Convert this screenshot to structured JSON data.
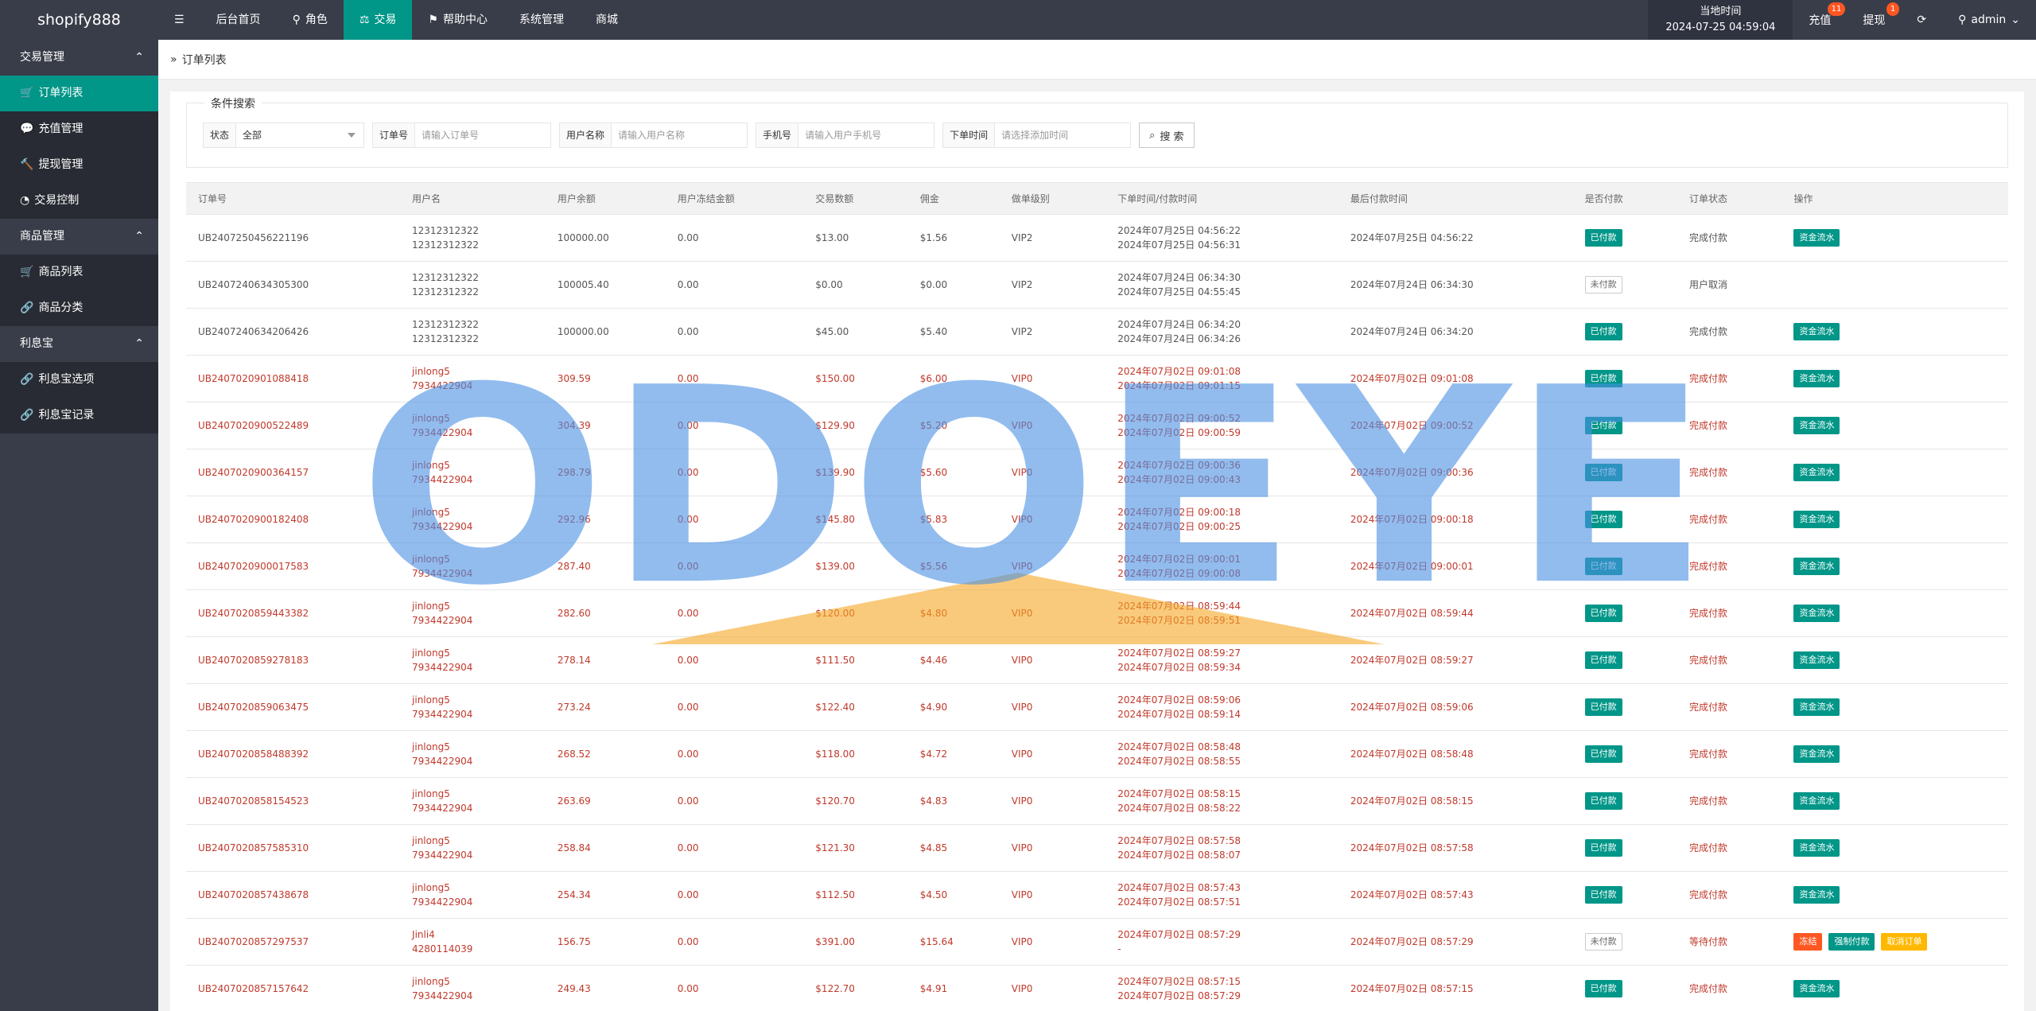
{
  "header": {
    "logo": "shopify888",
    "menu_icon": "menu-icon",
    "nav": [
      {
        "label": "后台首页",
        "icon": ""
      },
      {
        "label": "角色",
        "icon": "user-icon"
      },
      {
        "label": "交易",
        "icon": "scale-icon",
        "active": true
      },
      {
        "label": "帮助中心",
        "icon": "flag-icon"
      },
      {
        "label": "系统管理",
        "icon": ""
      },
      {
        "label": "商城",
        "icon": ""
      }
    ],
    "clock_label": "当地时间",
    "clock_value": "2024-07-25 04:59:04",
    "recharge_label": "充值",
    "recharge_badge": "11",
    "withdraw_label": "提现",
    "withdraw_badge": "1",
    "user": "admin"
  },
  "sidebar": {
    "groups": [
      {
        "label": "交易管理",
        "items": [
          {
            "label": "订单列表",
            "icon": "cart-icon",
            "active": true
          },
          {
            "label": "充值管理",
            "icon": "chat-icon"
          },
          {
            "label": "提现管理",
            "icon": "hammer-icon"
          },
          {
            "label": "交易控制",
            "icon": "dashboard-icon"
          }
        ]
      },
      {
        "label": "商品管理",
        "items": [
          {
            "label": "商品列表",
            "icon": "cart-icon"
          },
          {
            "label": "商品分类",
            "icon": "link-icon"
          }
        ]
      },
      {
        "label": "利息宝",
        "items": [
          {
            "label": "利息宝选项",
            "icon": "link-icon"
          },
          {
            "label": "利息宝记录",
            "icon": "link-icon"
          }
        ]
      }
    ]
  },
  "breadcrumb": {
    "label": "订单列表"
  },
  "filter": {
    "legend": "条件搜索",
    "status_label": "状态",
    "status_value": "全部",
    "order_label": "订单号",
    "order_placeholder": "请输入订单号",
    "username_label": "用户名称",
    "username_placeholder": "请输入用户名称",
    "phone_label": "手机号",
    "phone_placeholder": "请输入用户手机号",
    "time_label": "下单时间",
    "time_placeholder": "请选择添加时间",
    "search_label": "搜 索"
  },
  "table": {
    "columns": [
      "订单号",
      "用户名",
      "用户余额",
      "用户冻结金额",
      "交易数额",
      "佣金",
      "做单级别",
      "下单时间/付款时间",
      "最后付款时间",
      "是否付款",
      "订单状态",
      "操作"
    ],
    "rows": [
      {
        "id": "UB2407250456221196",
        "user1": "12312312322",
        "user2": "12312312322",
        "balance": "100000.00",
        "frozen": "0.00",
        "amount": "$13.00",
        "commission": "$1.56",
        "level": "VIP2",
        "t1": "2024年07月25日 04:56:22",
        "t2": "2024年07月25日 04:56:31",
        "last": "2024年07月25日 04:56:22",
        "paid": "已付款",
        "paid_state": "paid",
        "status": "完成付款",
        "ops": [
          "资金流水"
        ],
        "red": false
      },
      {
        "id": "UB2407240634305300",
        "user1": "12312312322",
        "user2": "12312312322",
        "balance": "100005.40",
        "frozen": "0.00",
        "amount": "$0.00",
        "commission": "$0.00",
        "level": "VIP2",
        "t1": "2024年07月24日 06:34:30",
        "t2": "2024年07月25日 04:55:45",
        "last": "2024年07月24日 06:34:30",
        "paid": "未付款",
        "paid_state": "unpaid",
        "status": "用户取消",
        "ops": [],
        "red": false
      },
      {
        "id": "UB2407240634206426",
        "user1": "12312312322",
        "user2": "12312312322",
        "balance": "100000.00",
        "frozen": "0.00",
        "amount": "$45.00",
        "commission": "$5.40",
        "level": "VIP2",
        "t1": "2024年07月24日 06:34:20",
        "t2": "2024年07月24日 06:34:26",
        "last": "2024年07月24日 06:34:20",
        "paid": "已付款",
        "paid_state": "paid",
        "status": "完成付款",
        "ops": [
          "资金流水"
        ],
        "red": false
      },
      {
        "id": "UB2407020901088418",
        "user1": "jinlong5",
        "user2": "7934422904",
        "balance": "309.59",
        "frozen": "0.00",
        "amount": "$150.00",
        "commission": "$6.00",
        "level": "VIP0",
        "t1": "2024年07月02日 09:01:08",
        "t2": "2024年07月02日 09:01:15",
        "last": "2024年07月02日 09:01:08",
        "paid": "已付款",
        "paid_state": "paid",
        "status": "完成付款",
        "ops": [
          "资金流水"
        ],
        "red": true
      },
      {
        "id": "UB2407020900522489",
        "user1": "jinlong5",
        "user2": "7934422904",
        "balance": "304.39",
        "frozen": "0.00",
        "amount": "$129.90",
        "commission": "$5.20",
        "level": "VIP0",
        "t1": "2024年07月02日 09:00:52",
        "t2": "2024年07月02日 09:00:59",
        "last": "2024年07月02日 09:00:52",
        "paid": "已付款",
        "paid_state": "paid",
        "status": "完成付款",
        "ops": [
          "资金流水"
        ],
        "red": true
      },
      {
        "id": "UB2407020900364157",
        "user1": "jinlong5",
        "user2": "7934422904",
        "balance": "298.79",
        "frozen": "0.00",
        "amount": "$139.90",
        "commission": "$5.60",
        "level": "VIP0",
        "t1": "2024年07月02日 09:00:36",
        "t2": "2024年07月02日 09:00:43",
        "last": "2024年07月02日 09:00:36",
        "paid": "已付款",
        "paid_state": "paid",
        "status": "完成付款",
        "ops": [
          "资金流水"
        ],
        "red": true
      },
      {
        "id": "UB2407020900182408",
        "user1": "jinlong5",
        "user2": "7934422904",
        "balance": "292.96",
        "frozen": "0.00",
        "amount": "$145.80",
        "commission": "$5.83",
        "level": "VIP0",
        "t1": "2024年07月02日 09:00:18",
        "t2": "2024年07月02日 09:00:25",
        "last": "2024年07月02日 09:00:18",
        "paid": "已付款",
        "paid_state": "paid",
        "status": "完成付款",
        "ops": [
          "资金流水"
        ],
        "red": true
      },
      {
        "id": "UB2407020900017583",
        "user1": "jinlong5",
        "user2": "7934422904",
        "balance": "287.40",
        "frozen": "0.00",
        "amount": "$139.00",
        "commission": "$5.56",
        "level": "VIP0",
        "t1": "2024年07月02日 09:00:01",
        "t2": "2024年07月02日 09:00:08",
        "last": "2024年07月02日 09:00:01",
        "paid": "已付款",
        "paid_state": "paid",
        "status": "完成付款",
        "ops": [
          "资金流水"
        ],
        "red": true
      },
      {
        "id": "UB2407020859443382",
        "user1": "jinlong5",
        "user2": "7934422904",
        "balance": "282.60",
        "frozen": "0.00",
        "amount": "$120.00",
        "commission": "$4.80",
        "level": "VIP0",
        "t1": "2024年07月02日 08:59:44",
        "t2": "2024年07月02日 08:59:51",
        "last": "2024年07月02日 08:59:44",
        "paid": "已付款",
        "paid_state": "paid",
        "status": "完成付款",
        "ops": [
          "资金流水"
        ],
        "red": true
      },
      {
        "id": "UB2407020859278183",
        "user1": "jinlong5",
        "user2": "7934422904",
        "balance": "278.14",
        "frozen": "0.00",
        "amount": "$111.50",
        "commission": "$4.46",
        "level": "VIP0",
        "t1": "2024年07月02日 08:59:27",
        "t2": "2024年07月02日 08:59:34",
        "last": "2024年07月02日 08:59:27",
        "paid": "已付款",
        "paid_state": "paid",
        "status": "完成付款",
        "ops": [
          "资金流水"
        ],
        "red": true
      },
      {
        "id": "UB2407020859063475",
        "user1": "jinlong5",
        "user2": "7934422904",
        "balance": "273.24",
        "frozen": "0.00",
        "amount": "$122.40",
        "commission": "$4.90",
        "level": "VIP0",
        "t1": "2024年07月02日 08:59:06",
        "t2": "2024年07月02日 08:59:14",
        "last": "2024年07月02日 08:59:06",
        "paid": "已付款",
        "paid_state": "paid",
        "status": "完成付款",
        "ops": [
          "资金流水"
        ],
        "red": true
      },
      {
        "id": "UB2407020858488392",
        "user1": "jinlong5",
        "user2": "7934422904",
        "balance": "268.52",
        "frozen": "0.00",
        "amount": "$118.00",
        "commission": "$4.72",
        "level": "VIP0",
        "t1": "2024年07月02日 08:58:48",
        "t2": "2024年07月02日 08:58:55",
        "last": "2024年07月02日 08:58:48",
        "paid": "已付款",
        "paid_state": "paid",
        "status": "完成付款",
        "ops": [
          "资金流水"
        ],
        "red": true
      },
      {
        "id": "UB2407020858154523",
        "user1": "jinlong5",
        "user2": "7934422904",
        "balance": "263.69",
        "frozen": "0.00",
        "amount": "$120.70",
        "commission": "$4.83",
        "level": "VIP0",
        "t1": "2024年07月02日 08:58:15",
        "t2": "2024年07月02日 08:58:22",
        "last": "2024年07月02日 08:58:15",
        "paid": "已付款",
        "paid_state": "paid",
        "status": "完成付款",
        "ops": [
          "资金流水"
        ],
        "red": true
      },
      {
        "id": "UB2407020857585310",
        "user1": "jinlong5",
        "user2": "7934422904",
        "balance": "258.84",
        "frozen": "0.00",
        "amount": "$121.30",
        "commission": "$4.85",
        "level": "VIP0",
        "t1": "2024年07月02日 08:57:58",
        "t2": "2024年07月02日 08:58:07",
        "last": "2024年07月02日 08:57:58",
        "paid": "已付款",
        "paid_state": "paid",
        "status": "完成付款",
        "ops": [
          "资金流水"
        ],
        "red": true
      },
      {
        "id": "UB2407020857438678",
        "user1": "jinlong5",
        "user2": "7934422904",
        "balance": "254.34",
        "frozen": "0.00",
        "amount": "$112.50",
        "commission": "$4.50",
        "level": "VIP0",
        "t1": "2024年07月02日 08:57:43",
        "t2": "2024年07月02日 08:57:51",
        "last": "2024年07月02日 08:57:43",
        "paid": "已付款",
        "paid_state": "paid",
        "status": "完成付款",
        "ops": [
          "资金流水"
        ],
        "red": true
      },
      {
        "id": "UB2407020857297537",
        "user1": "Jinli4",
        "user2": "4280114039",
        "balance": "156.75",
        "frozen": "0.00",
        "amount": "$391.00",
        "commission": "$15.64",
        "level": "VIP0",
        "t1": "2024年07月02日 08:57:29",
        "t2": "-",
        "last": "2024年07月02日 08:57:29",
        "paid": "未付款",
        "paid_state": "unpaid",
        "status": "等待付款",
        "ops": [
          "冻结",
          "强制付款",
          "取消订单"
        ],
        "red": true
      },
      {
        "id": "UB2407020857157642",
        "user1": "jinlong5",
        "user2": "7934422904",
        "balance": "249.43",
        "frozen": "0.00",
        "amount": "$122.70",
        "commission": "$4.91",
        "level": "VIP0",
        "t1": "2024年07月02日 08:57:15",
        "t2": "2024年07月02日 08:57:29",
        "last": "2024年07月02日 08:57:15",
        "paid": "已付款",
        "paid_state": "paid",
        "status": "完成付款",
        "ops": [
          "资金流水"
        ],
        "red": true
      }
    ]
  },
  "watermark": {
    "text": "ODOEYE",
    "color": "#4a90e2",
    "accent": "#f5a623"
  }
}
